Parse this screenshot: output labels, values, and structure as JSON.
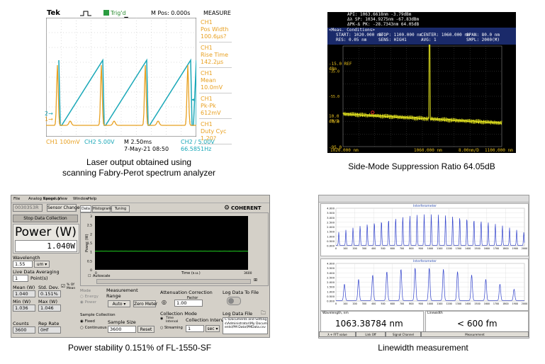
{
  "captions": {
    "osc": [
      "Laser output obtained using",
      "scanning Fabry-Perot spectrum analyzer"
    ],
    "osa": "Side-Mode Suppression Ratio 64.05dB",
    "power": "Power stability 0.151% of FL-1550-SF",
    "linewidth": "Linewidth measurement"
  },
  "osc": {
    "brand": "Tek",
    "trig": "Trig'd",
    "mpos": "M Pos: 0.000s",
    "measure_title": "MEASURE",
    "measurements": [
      {
        "ch": "CH1",
        "name": "Pos Width",
        "value": "100.6µs?"
      },
      {
        "ch": "CH1",
        "name": "Rise Time",
        "value": "142.2µs"
      },
      {
        "ch": "CH1",
        "name": "Mean",
        "value": "10.0mV"
      },
      {
        "ch": "CH1",
        "name": "Pk-Pk",
        "value": "612mV"
      },
      {
        "ch": "CH1",
        "name": "Duty Cyc",
        "value": "1.20?"
      }
    ],
    "ch1": "CH1  100mV",
    "ch2": "CH2  5.00V",
    "timebase": "M 2.50ms",
    "date": "7-May-21 08:50",
    "ch2_trig": "CH2 ∕ 5.00V",
    "freq": "66.5851Hz",
    "marker1": "1→",
    "marker2": "2→",
    "colors": {
      "ch1": "#e8a020",
      "ch2": "#1aa8b8",
      "grid": "#a8a8a8"
    }
  },
  "osa": {
    "header_lines": [
      "API:  1063.6618nm    -3.79dBm",
      "Δλ SP:  1034.9275nm   -67.83dBm",
      "ΔPK-Δ PK:  -28.7343nm    64.05dB"
    ],
    "meas_label": "<Meas. Conditions>",
    "start": "START: 1020.000 nm",
    "stop": "STOP: 1100.000 nm",
    "center": "CENTER: 1060.000 nm",
    "span": "SPAN:   80.0 nm",
    "res": "RES:   0.05 nm",
    "sens": "SENS: HIGH1",
    "avg": "AVG:   1",
    "smpl": "SMPL:  2000(M)",
    "ref": "-15.0 REF",
    "ref_unit": "dBm",
    "left_ticks": [
      "",
      "-35.0",
      "-55.0",
      "-75.0",
      "-95.0"
    ],
    "scale": "10.0",
    "scale_unit": "dB/D",
    "x_start": "1020.000 nm",
    "x_center": "1060.000 nm",
    "x_div": "8.00nm/D",
    "x_stop": "1100.000 nm"
  },
  "power": {
    "menu": [
      "File",
      "Analog Range",
      "Speedup",
      "View",
      "Window",
      "Help"
    ],
    "serial": "0030353R",
    "sensor_btn": "Sensor Changed",
    "stop_btn": "Stop Data Collection",
    "tabs": [
      "Data",
      "Histogram",
      "Tuning"
    ],
    "brand": "COHERENT",
    "title": "Power (W)",
    "reading": "1.040W",
    "wavelength_label": "Wavelength",
    "wavelength": "1.55",
    "wavelength_unit": "um",
    "averaging_label": "Live Data Averaging",
    "averaging": "1",
    "averaging_unit": "Point(s)",
    "mean_label": "Mean (W)",
    "stddev_label": "Std. Dev.",
    "pct_label": "% Of Mean",
    "mean": "1.040",
    "stddev": "0.151%",
    "min_label": "Min (W)",
    "max_label": "Max (W)",
    "min": "1.036",
    "max": "1.046",
    "counts_label": "Counts",
    "reprate_label": "Rep Rate",
    "counts": "3600",
    "reprate": "0Hf",
    "y_axis": "Power (W)",
    "x_axis": "Time (s.u.)",
    "y_ticks": [
      "3",
      "2.5",
      "2",
      "1.5",
      "1",
      "0.5",
      "0"
    ],
    "x_ticks": [
      "0",
      "3600"
    ],
    "autoscale": "Autoscale",
    "mode_label": "Mode",
    "mode_options": [
      "Energy",
      "Power"
    ],
    "range_label": "Measurement Range",
    "range_value": "Auto",
    "zero_btn": "Zero Meter",
    "atten_label": "Attenuation Correction",
    "factor_label": "Factor",
    "factor": "1.00",
    "log_label": "Log Data To File",
    "sample_coll_label": "Sample Collection",
    "sample_options": [
      "Fixed",
      "Continuous"
    ],
    "sample_size_label": "Sample Size",
    "sample_size": "3600",
    "reset_btn": "Reset",
    "coll_mode_label": "Collection Mode",
    "coll_options": [
      "Time Interval",
      "Streaming"
    ],
    "interval_label": "Collection Interval",
    "interval": "1",
    "interval_unit": "sec",
    "logfile_label": "Log Data File",
    "logfile": "C:\\Documents and Settings\\Administrator\\My Documents\\PM Data\\PMData.csv"
  },
  "linewidth": {
    "top_title": "Interferometer",
    "bottom_title": "Interferometer",
    "y_ticks_top": [
      "4.000",
      "3.500",
      "3.000",
      "2.500",
      "2.000",
      "1.500",
      "1.000",
      "0.500",
      "0.000"
    ],
    "y_ticks_bottom": [
      "4.000",
      "3.500",
      "3.000",
      "2.500",
      "2.000",
      "1.500",
      "1.000",
      "0.500",
      "0.000"
    ],
    "x_ticks": [
      "0",
      "100",
      "200",
      "300",
      "400",
      "500",
      "600",
      "700",
      "800",
      "900",
      "1000",
      "1100",
      "1200",
      "1300",
      "1400",
      "1500",
      "1600",
      "1700",
      "1800",
      "1900",
      "2000"
    ],
    "wavelength_label": "Wavelength, nm",
    "linewidth_label": "Linewidth",
    "wavelength": "1063.38784 nm",
    "linewidth": "< 600 fm",
    "tabs": [
      "λ + FFT value",
      "Link Off",
      "Signal Channel",
      "Measurement"
    ]
  }
}
